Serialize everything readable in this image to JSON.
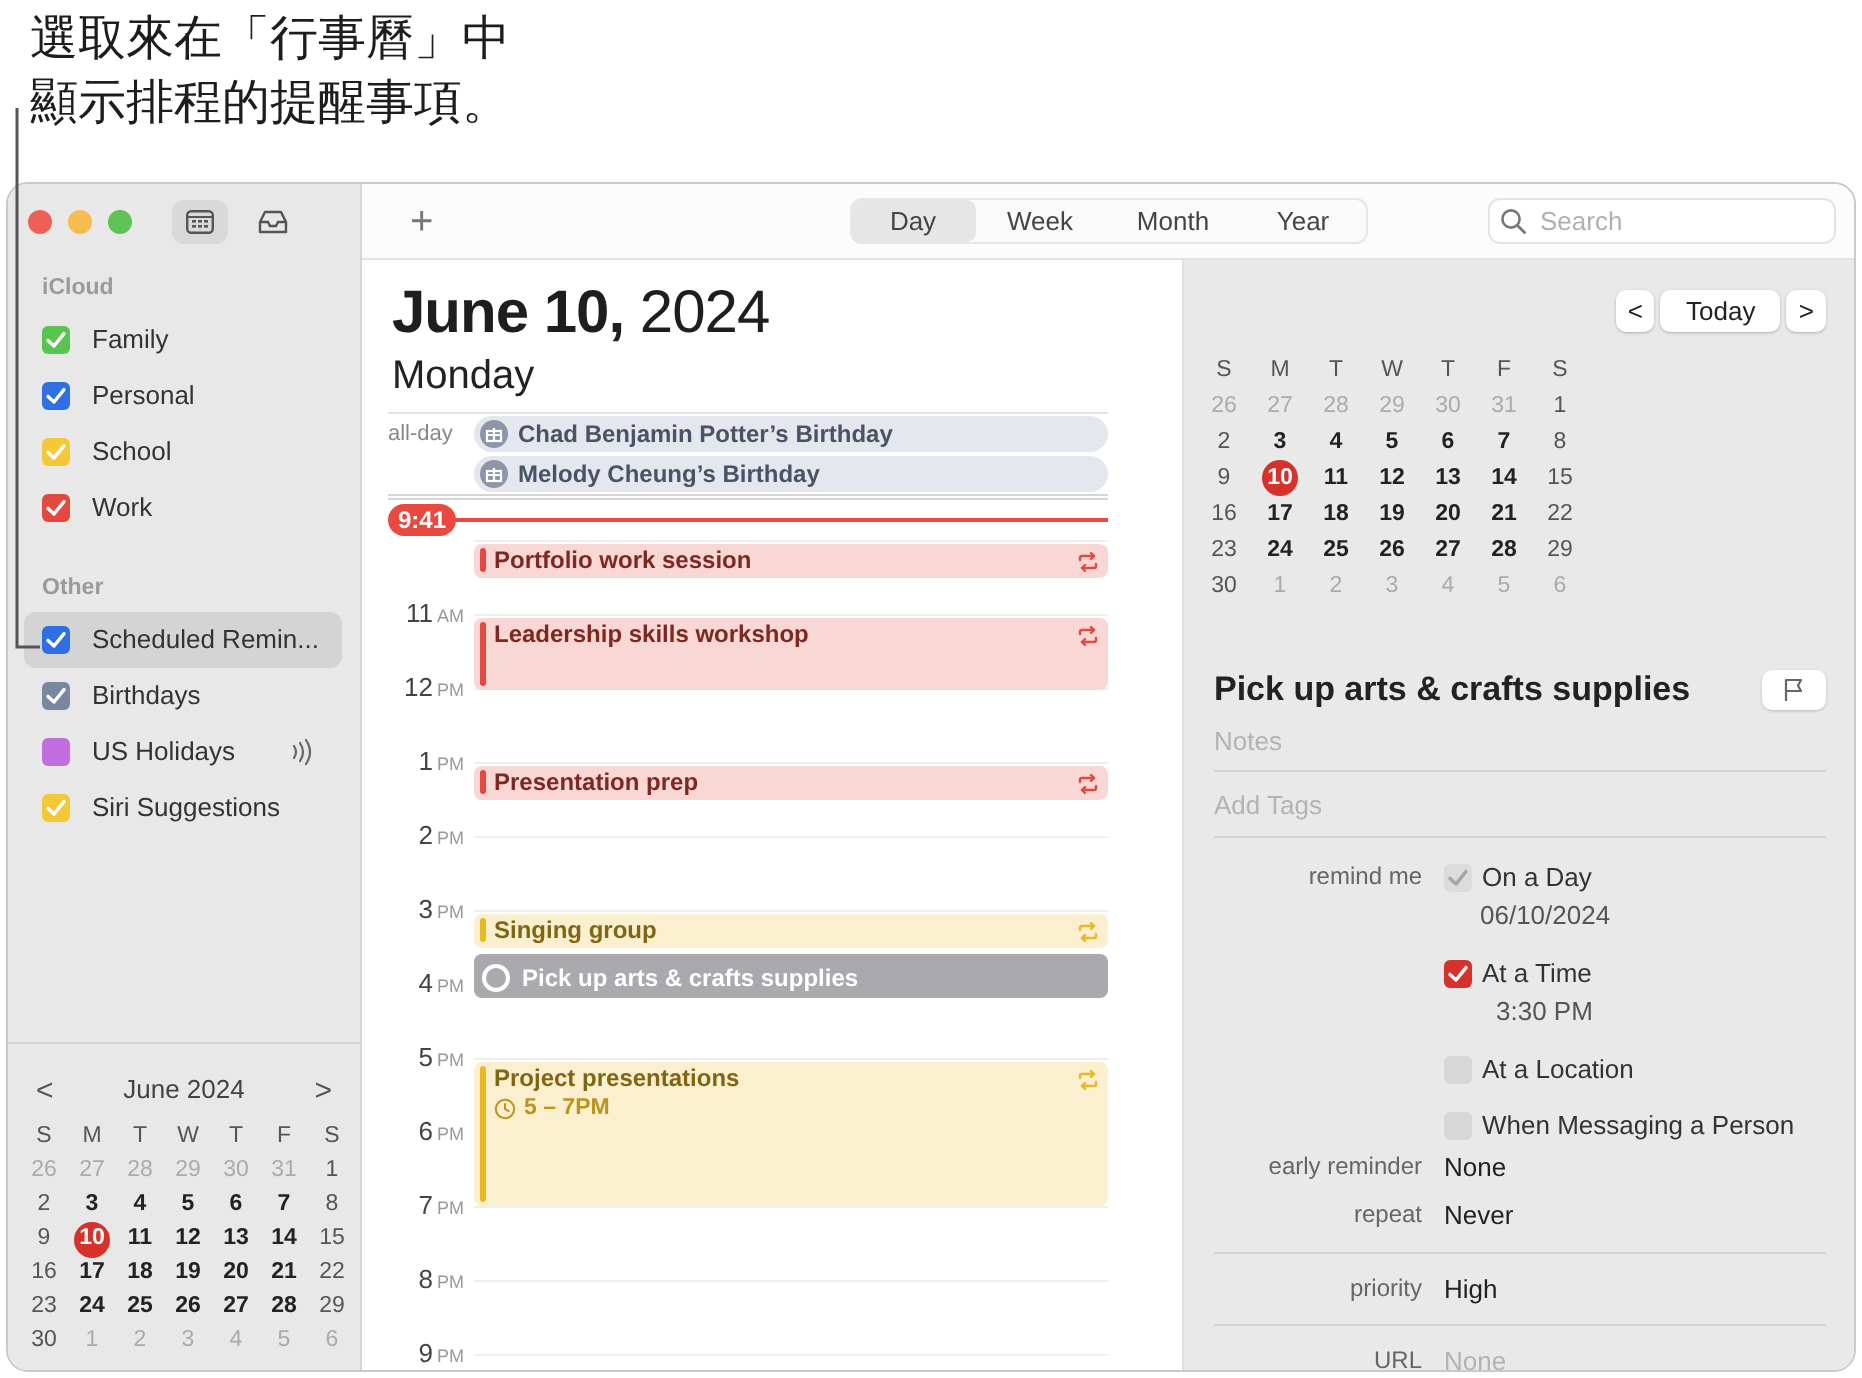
{
  "callout": {
    "lines": [
      "選取來在「行事曆」中",
      "顯示排程的提醒事項。"
    ]
  },
  "sidebar": {
    "sections": [
      {
        "heading": "iCloud",
        "calendars": [
          {
            "label": "Family",
            "color": "#5ac451",
            "checked": true,
            "selected": false,
            "subscribed": false
          },
          {
            "label": "Personal",
            "color": "#2f6fe4",
            "checked": true,
            "selected": false,
            "subscribed": false
          },
          {
            "label": "School",
            "color": "#f5c936",
            "checked": true,
            "selected": false,
            "subscribed": false
          },
          {
            "label": "Work",
            "color": "#e5483e",
            "checked": true,
            "selected": false,
            "subscribed": false
          }
        ]
      },
      {
        "heading": "Other",
        "calendars": [
          {
            "label": "Scheduled Remin...",
            "color": "#2f6fe4",
            "checked": true,
            "selected": true,
            "subscribed": false
          },
          {
            "label": "Birthdays",
            "color": "#7b86a3",
            "checked": true,
            "selected": false,
            "subscribed": false
          },
          {
            "label": "US Holidays",
            "color": "#c36ee0",
            "checked": false,
            "selected": false,
            "subscribed": true
          },
          {
            "label": "Siri Suggestions",
            "color": "#f5c936",
            "checked": true,
            "selected": false,
            "subscribed": false
          }
        ]
      }
    ],
    "mini_calendar": {
      "title": "June 2024",
      "prev": "<",
      "next": ">",
      "weekdays": [
        "S",
        "M",
        "T",
        "W",
        "T",
        "F",
        "S"
      ],
      "weeks": [
        [
          {
            "d": "26",
            "kind": "outside"
          },
          {
            "d": "27",
            "kind": "outside"
          },
          {
            "d": "28",
            "kind": "outside"
          },
          {
            "d": "29",
            "kind": "outside"
          },
          {
            "d": "30",
            "kind": "outside"
          },
          {
            "d": "31",
            "kind": "outside"
          },
          {
            "d": "1",
            "kind": "current"
          }
        ],
        [
          {
            "d": "2",
            "kind": "current"
          },
          {
            "d": "3",
            "kind": "current"
          },
          {
            "d": "4",
            "kind": "current"
          },
          {
            "d": "5",
            "kind": "current"
          },
          {
            "d": "6",
            "kind": "current"
          },
          {
            "d": "7",
            "kind": "current"
          },
          {
            "d": "8",
            "kind": "current"
          }
        ],
        [
          {
            "d": "9",
            "kind": "current"
          },
          {
            "d": "10",
            "kind": "today"
          },
          {
            "d": "11",
            "kind": "current"
          },
          {
            "d": "12",
            "kind": "current"
          },
          {
            "d": "13",
            "kind": "current"
          },
          {
            "d": "14",
            "kind": "current"
          },
          {
            "d": "15",
            "kind": "current"
          }
        ],
        [
          {
            "d": "16",
            "kind": "current"
          },
          {
            "d": "17",
            "kind": "current"
          },
          {
            "d": "18",
            "kind": "current"
          },
          {
            "d": "19",
            "kind": "current"
          },
          {
            "d": "20",
            "kind": "current"
          },
          {
            "d": "21",
            "kind": "current"
          },
          {
            "d": "22",
            "kind": "current"
          }
        ],
        [
          {
            "d": "23",
            "kind": "current"
          },
          {
            "d": "24",
            "kind": "current"
          },
          {
            "d": "25",
            "kind": "current"
          },
          {
            "d": "26",
            "kind": "current"
          },
          {
            "d": "27",
            "kind": "current"
          },
          {
            "d": "28",
            "kind": "current"
          },
          {
            "d": "29",
            "kind": "current"
          }
        ],
        [
          {
            "d": "30",
            "kind": "current"
          },
          {
            "d": "1",
            "kind": "outside"
          },
          {
            "d": "2",
            "kind": "outside"
          },
          {
            "d": "3",
            "kind": "outside"
          },
          {
            "d": "4",
            "kind": "outside"
          },
          {
            "d": "5",
            "kind": "outside"
          },
          {
            "d": "6",
            "kind": "outside"
          }
        ]
      ]
    }
  },
  "toolbar": {
    "add": "+",
    "views": [
      {
        "label": "Day",
        "selected": true
      },
      {
        "label": "Week",
        "selected": false
      },
      {
        "label": "Month",
        "selected": false
      },
      {
        "label": "Year",
        "selected": false
      }
    ],
    "search": {
      "placeholder": "Search"
    }
  },
  "day_view": {
    "date": "**June 10,** 2024",
    "weekday": "Monday",
    "all_day_label": "all-day",
    "all_day": [
      {
        "title": "Chad Benjamin Potter’s Birthday"
      },
      {
        "title": "Melody Cheung’s Birthday"
      }
    ],
    "now": "9:41",
    "hours": [
      {
        "events": [
          {
            "title": "Portfolio work session",
            "kind": "short",
            "color": "#e5483e",
            "repeats": true
          }
        ]
      },
      {
        "hour": "11",
        "period": "AM",
        "events": [
          {
            "title": "Leadership skills workshop",
            "kind": "hour",
            "color": "#e5483e",
            "repeats": true
          }
        ]
      },
      {
        "hour": "12",
        "period": "PM"
      },
      {
        "hour": "1",
        "period": "PM",
        "events": [
          {
            "title": "Presentation prep",
            "kind": "short",
            "color": "#e5483e",
            "repeats": true
          }
        ]
      },
      {
        "hour": "2",
        "period": "PM"
      },
      {
        "hour": "3",
        "period": "PM",
        "events": [
          {
            "title": "Singing group",
            "kind": "short",
            "color": "#e8b923",
            "repeats": true
          },
          {
            "title": "Pick up arts & crafts supplies",
            "kind": "reminder",
            "color": "#a9a9ae",
            "repeats": false
          }
        ]
      },
      {
        "hour": "4",
        "period": "PM"
      },
      {
        "hour": "5",
        "period": "PM",
        "events": [
          {
            "title": "Project presentations",
            "time": "5 – 7PM",
            "kind": "long",
            "color": "#e8b923",
            "repeats": true
          }
        ]
      },
      {
        "hour": "6",
        "period": "PM"
      },
      {
        "hour": "7",
        "period": "PM"
      },
      {
        "hour": "8",
        "period": "PM"
      },
      {
        "hour": "9",
        "period": "PM"
      }
    ]
  },
  "inspector": {
    "prev": "<",
    "today": "Today",
    "next": ">",
    "mini_calendar": {
      "weekdays": [
        "S",
        "M",
        "T",
        "W",
        "T",
        "F",
        "S"
      ],
      "weeks": [
        [
          {
            "d": "26",
            "kind": "outside"
          },
          {
            "d": "27",
            "kind": "outside"
          },
          {
            "d": "28",
            "kind": "outside"
          },
          {
            "d": "29",
            "kind": "outside"
          },
          {
            "d": "30",
            "kind": "outside"
          },
          {
            "d": "31",
            "kind": "outside"
          },
          {
            "d": "1",
            "kind": "current"
          }
        ],
        [
          {
            "d": "2",
            "kind": "current"
          },
          {
            "d": "3",
            "kind": "current"
          },
          {
            "d": "4",
            "kind": "current"
          },
          {
            "d": "5",
            "kind": "current"
          },
          {
            "d": "6",
            "kind": "current"
          },
          {
            "d": "7",
            "kind": "current"
          },
          {
            "d": "8",
            "kind": "current"
          }
        ],
        [
          {
            "d": "9",
            "kind": "current"
          },
          {
            "d": "10",
            "kind": "today"
          },
          {
            "d": "11",
            "kind": "current"
          },
          {
            "d": "12",
            "kind": "current"
          },
          {
            "d": "13",
            "kind": "current"
          },
          {
            "d": "14",
            "kind": "current"
          },
          {
            "d": "15",
            "kind": "current"
          }
        ],
        [
          {
            "d": "16",
            "kind": "current"
          },
          {
            "d": "17",
            "kind": "current"
          },
          {
            "d": "18",
            "kind": "current"
          },
          {
            "d": "19",
            "kind": "current"
          },
          {
            "d": "20",
            "kind": "current"
          },
          {
            "d": "21",
            "kind": "current"
          },
          {
            "d": "22",
            "kind": "current"
          }
        ],
        [
          {
            "d": "23",
            "kind": "current"
          },
          {
            "d": "24",
            "kind": "current"
          },
          {
            "d": "25",
            "kind": "current"
          },
          {
            "d": "26",
            "kind": "current"
          },
          {
            "d": "27",
            "kind": "current"
          },
          {
            "d": "28",
            "kind": "current"
          },
          {
            "d": "29",
            "kind": "current"
          }
        ],
        [
          {
            "d": "30",
            "kind": "current"
          },
          {
            "d": "1",
            "kind": "outside"
          },
          {
            "d": "2",
            "kind": "outside"
          },
          {
            "d": "3",
            "kind": "outside"
          },
          {
            "d": "4",
            "kind": "outside"
          },
          {
            "d": "5",
            "kind": "outside"
          },
          {
            "d": "6",
            "kind": "outside"
          }
        ]
      ]
    },
    "detail": {
      "title": "Pick up arts & crafts supplies",
      "notes": {
        "placeholder": "Notes"
      },
      "tags": {
        "placeholder": "Add Tags"
      },
      "remind_label": "remind me",
      "remind_options": [
        {
          "label": "On a Day",
          "value": "06/10/2024",
          "checked": true,
          "disabled": true
        },
        {
          "label": "At a Time",
          "value": "3:30 PM",
          "checked": true,
          "disabled": false
        },
        {
          "label": "At a Location",
          "checked": false,
          "disabled": false
        },
        {
          "label": "When Messaging a Person",
          "checked": false,
          "disabled": false
        }
      ],
      "field_groups": [
        [
          {
            "label": "early reminder",
            "value": "None"
          },
          {
            "label": "repeat",
            "value": "Never"
          }
        ],
        [
          {
            "label": "priority",
            "value": "High"
          }
        ],
        [
          {
            "label": "URL",
            "placeholder": "None"
          }
        ]
      ]
    }
  }
}
